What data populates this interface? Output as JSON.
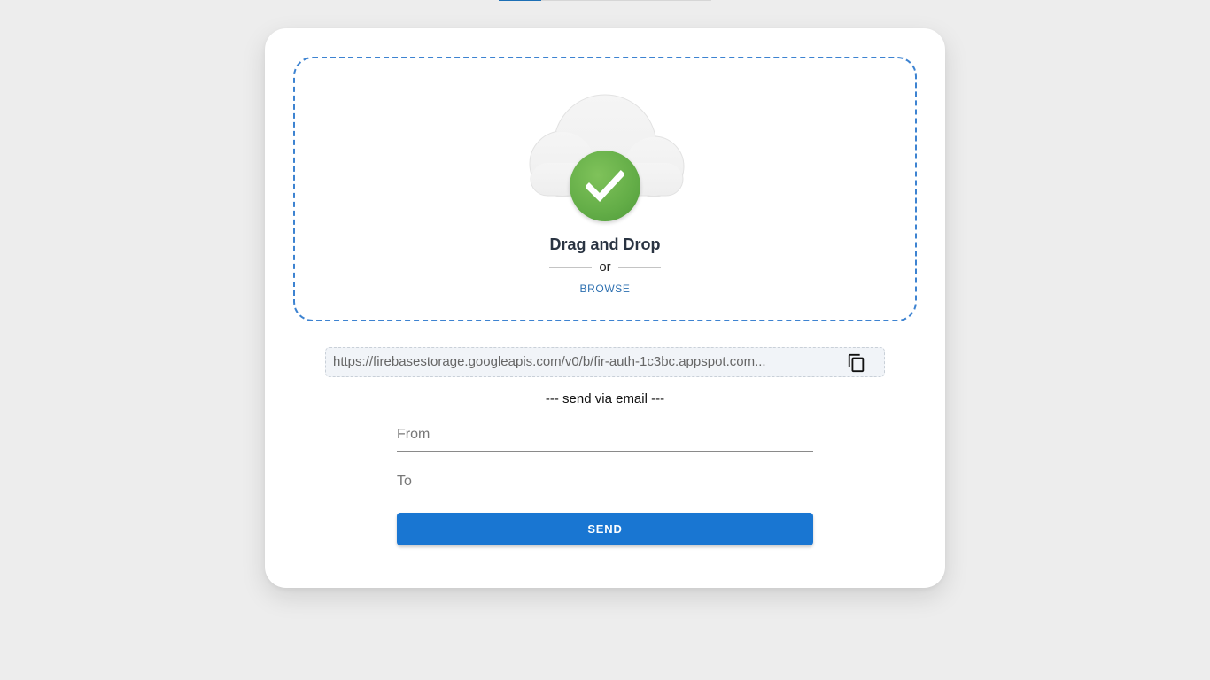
{
  "upload_progress": {
    "fraction": 0.2
  },
  "dropzone": {
    "icon": "cloud-icon",
    "status_icon": "checkmark-icon",
    "title": "Drag and Drop",
    "or_text": "or",
    "browse_label": "BROWSE"
  },
  "link": {
    "url": "https://firebasestorage.googleapis.com/v0/b/fir-auth-1c3bc.appspot.com...",
    "copy_icon": "copy-icon"
  },
  "email": {
    "divider_text": "--- send via email ---",
    "from_placeholder": "From",
    "to_placeholder": "To",
    "send_label": "SEND"
  },
  "colors": {
    "accent": "#1976d2",
    "dropzone_border": "#3d83d1",
    "success": "#63ad47",
    "link": "#2c6fb0"
  }
}
